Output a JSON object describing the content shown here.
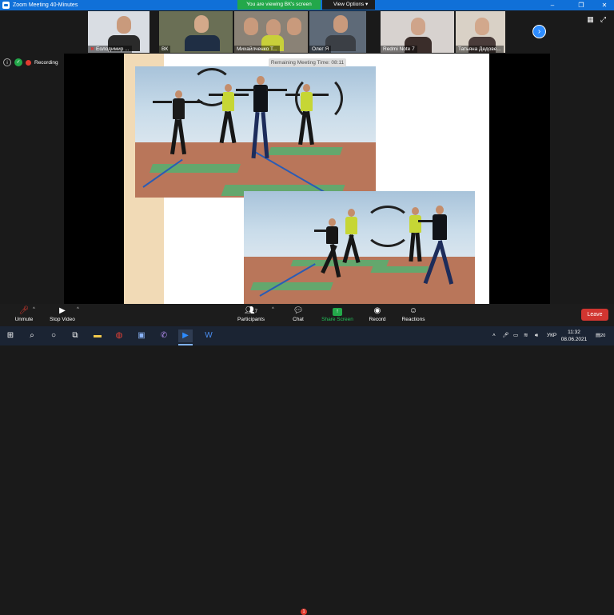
{
  "window": {
    "title": "Zoom Meeting 40-Minutes"
  },
  "banner": {
    "viewing_text": "You are viewing ВК's screen",
    "view_options": "View Options"
  },
  "window_controls": {
    "minimize": "–",
    "restore": "❐",
    "close": "✕",
    "screen": "⤢"
  },
  "participants": [
    {
      "name": "Еолодимир ..."
    },
    {
      "name": "ВК"
    },
    {
      "name": "Михайлченко Т..."
    },
    {
      "name": "Олег Я"
    },
    {
      "name": "Redmi Note 7"
    },
    {
      "name": "Татьяна Дедове..."
    }
  ],
  "status": {
    "recording": "Recording"
  },
  "meeting_timer": "Remaining Meeting Time: 08:11",
  "toolbar": {
    "unmute": "Unmute",
    "stop_video": "Stop Video",
    "participants": "Participants",
    "participants_count": "7",
    "chat": "Chat",
    "chat_badge": "1",
    "share_screen": "Share Screen",
    "record": "Record",
    "reactions": "Reactions",
    "leave": "Leave"
  },
  "taskbar": {
    "language": "УКР",
    "time": "11:32",
    "date": "08.06.2021",
    "notification_count": "20"
  },
  "colors": {
    "zoom_blue": "#1070d8",
    "share_green": "#23a84a",
    "leave_red": "#d13530",
    "toolbar_bg": "#1c1c1c",
    "taskbar_bg": "#1b2433"
  }
}
